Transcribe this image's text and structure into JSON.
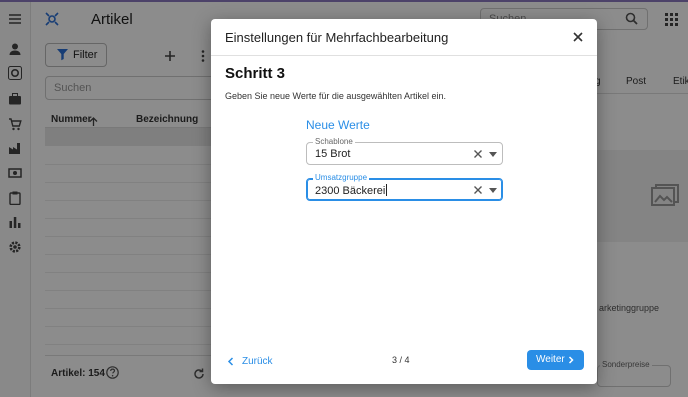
{
  "app": {
    "title": "Artikel",
    "search_placeholder": "Suchen",
    "filter_label": "Filter",
    "list_search_placeholder": "Suchen",
    "columns": [
      "Nummer",
      "Bezeichnung"
    ],
    "footer_count": "Artikel: 154",
    "right_tabs": [
      "g",
      "Post",
      "Etik"
    ],
    "right_label_1": "arketinggruppe",
    "right_label_2": "Sonderpreise"
  },
  "sidebar": {
    "icons": [
      "menu-icon",
      "person-icon",
      "gear-badge-icon",
      "briefcase-icon",
      "cart-icon",
      "factory-icon",
      "cash-icon",
      "clipboard-icon",
      "bar-chart-icon",
      "settings-icon"
    ]
  },
  "modal": {
    "title": "Einstellungen für Mehrfachbearbeitung",
    "step": "Schritt 3",
    "description": "Geben Sie neue Werte für die ausgewählten Artikel ein.",
    "section_title": "Neue Werte",
    "fields": [
      {
        "label": "Schablone",
        "value": "15 Brot"
      },
      {
        "label": "Umsatzgruppe",
        "value": "2300 Bäckerei"
      }
    ],
    "back_label": "Zurück",
    "pager": "3 / 4",
    "next_label": "Weiter"
  },
  "colors": {
    "accent": "#2a8ee6",
    "overlay": "rgba(0,0,0,0.45)"
  }
}
